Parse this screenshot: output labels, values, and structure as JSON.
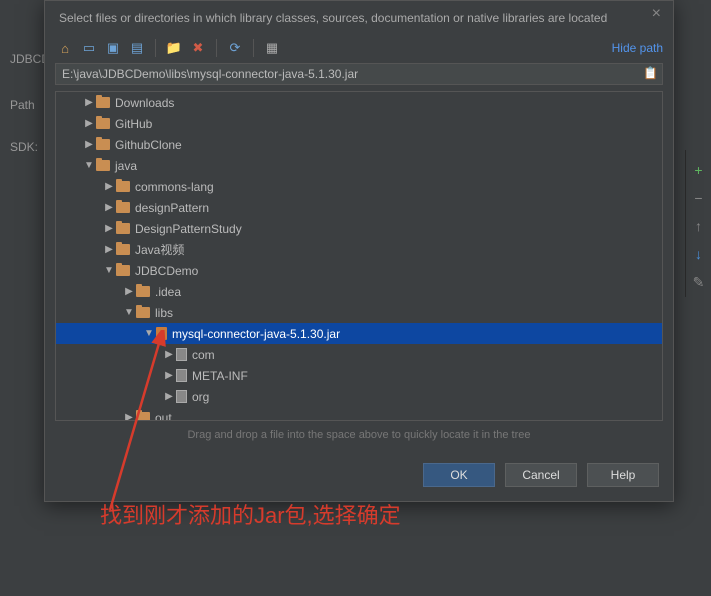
{
  "background": {
    "jdbc_label": "JDBCD",
    "path_label": "Path",
    "sdk_label": "SDK:"
  },
  "dialog": {
    "subtitle": "Select files or directories in which library classes, sources, documentation or native libraries are located",
    "hide_path": "Hide path",
    "path_value": "E:\\java\\JDBCDemo\\libs\\mysql-connector-java-5.1.30.jar",
    "drag_hint": "Drag and drop a file into the space above to quickly locate it in the tree",
    "buttons": {
      "ok": "OK",
      "cancel": "Cancel",
      "help": "Help"
    }
  },
  "tree": {
    "items": [
      {
        "depth": 1,
        "expanded": false,
        "icon": "folder",
        "label": "Downloads"
      },
      {
        "depth": 1,
        "expanded": false,
        "icon": "folder",
        "label": "GitHub"
      },
      {
        "depth": 1,
        "expanded": false,
        "icon": "folder",
        "label": "GithubClone"
      },
      {
        "depth": 1,
        "expanded": true,
        "icon": "folder",
        "label": "java"
      },
      {
        "depth": 2,
        "expanded": false,
        "icon": "folder",
        "label": "commons-lang"
      },
      {
        "depth": 2,
        "expanded": false,
        "icon": "folder",
        "label": "designPattern"
      },
      {
        "depth": 2,
        "expanded": false,
        "icon": "folder",
        "label": "DesignPatternStudy"
      },
      {
        "depth": 2,
        "expanded": false,
        "icon": "folder",
        "label": "Java视频"
      },
      {
        "depth": 2,
        "expanded": true,
        "icon": "folder",
        "label": "JDBCDemo"
      },
      {
        "depth": 3,
        "expanded": false,
        "icon": "folder",
        "label": ".idea"
      },
      {
        "depth": 3,
        "expanded": true,
        "icon": "folder",
        "label": "libs"
      },
      {
        "depth": 4,
        "expanded": true,
        "icon": "jar",
        "label": "mysql-connector-java-5.1.30.jar",
        "selected": true
      },
      {
        "depth": 5,
        "expanded": false,
        "icon": "pkg",
        "label": "com"
      },
      {
        "depth": 5,
        "expanded": false,
        "icon": "pkg",
        "label": "META-INF"
      },
      {
        "depth": 5,
        "expanded": false,
        "icon": "pkg",
        "label": "org"
      },
      {
        "depth": 3,
        "expanded": false,
        "icon": "folder",
        "label": "out"
      }
    ]
  },
  "annotation_text": "找到刚才添加的Jar包,选择确定",
  "toolbar_icons": {
    "home": "home-icon",
    "desktop": "desktop-icon",
    "project": "project-icon",
    "module": "module-icon",
    "new_folder": "new-folder-icon",
    "delete": "delete-icon",
    "refresh": "refresh-icon",
    "show_hidden": "show-hidden-icon"
  },
  "side_icons": {
    "add": "+",
    "minus": "−",
    "up": "↑",
    "down": "↓",
    "edit": "✎"
  }
}
